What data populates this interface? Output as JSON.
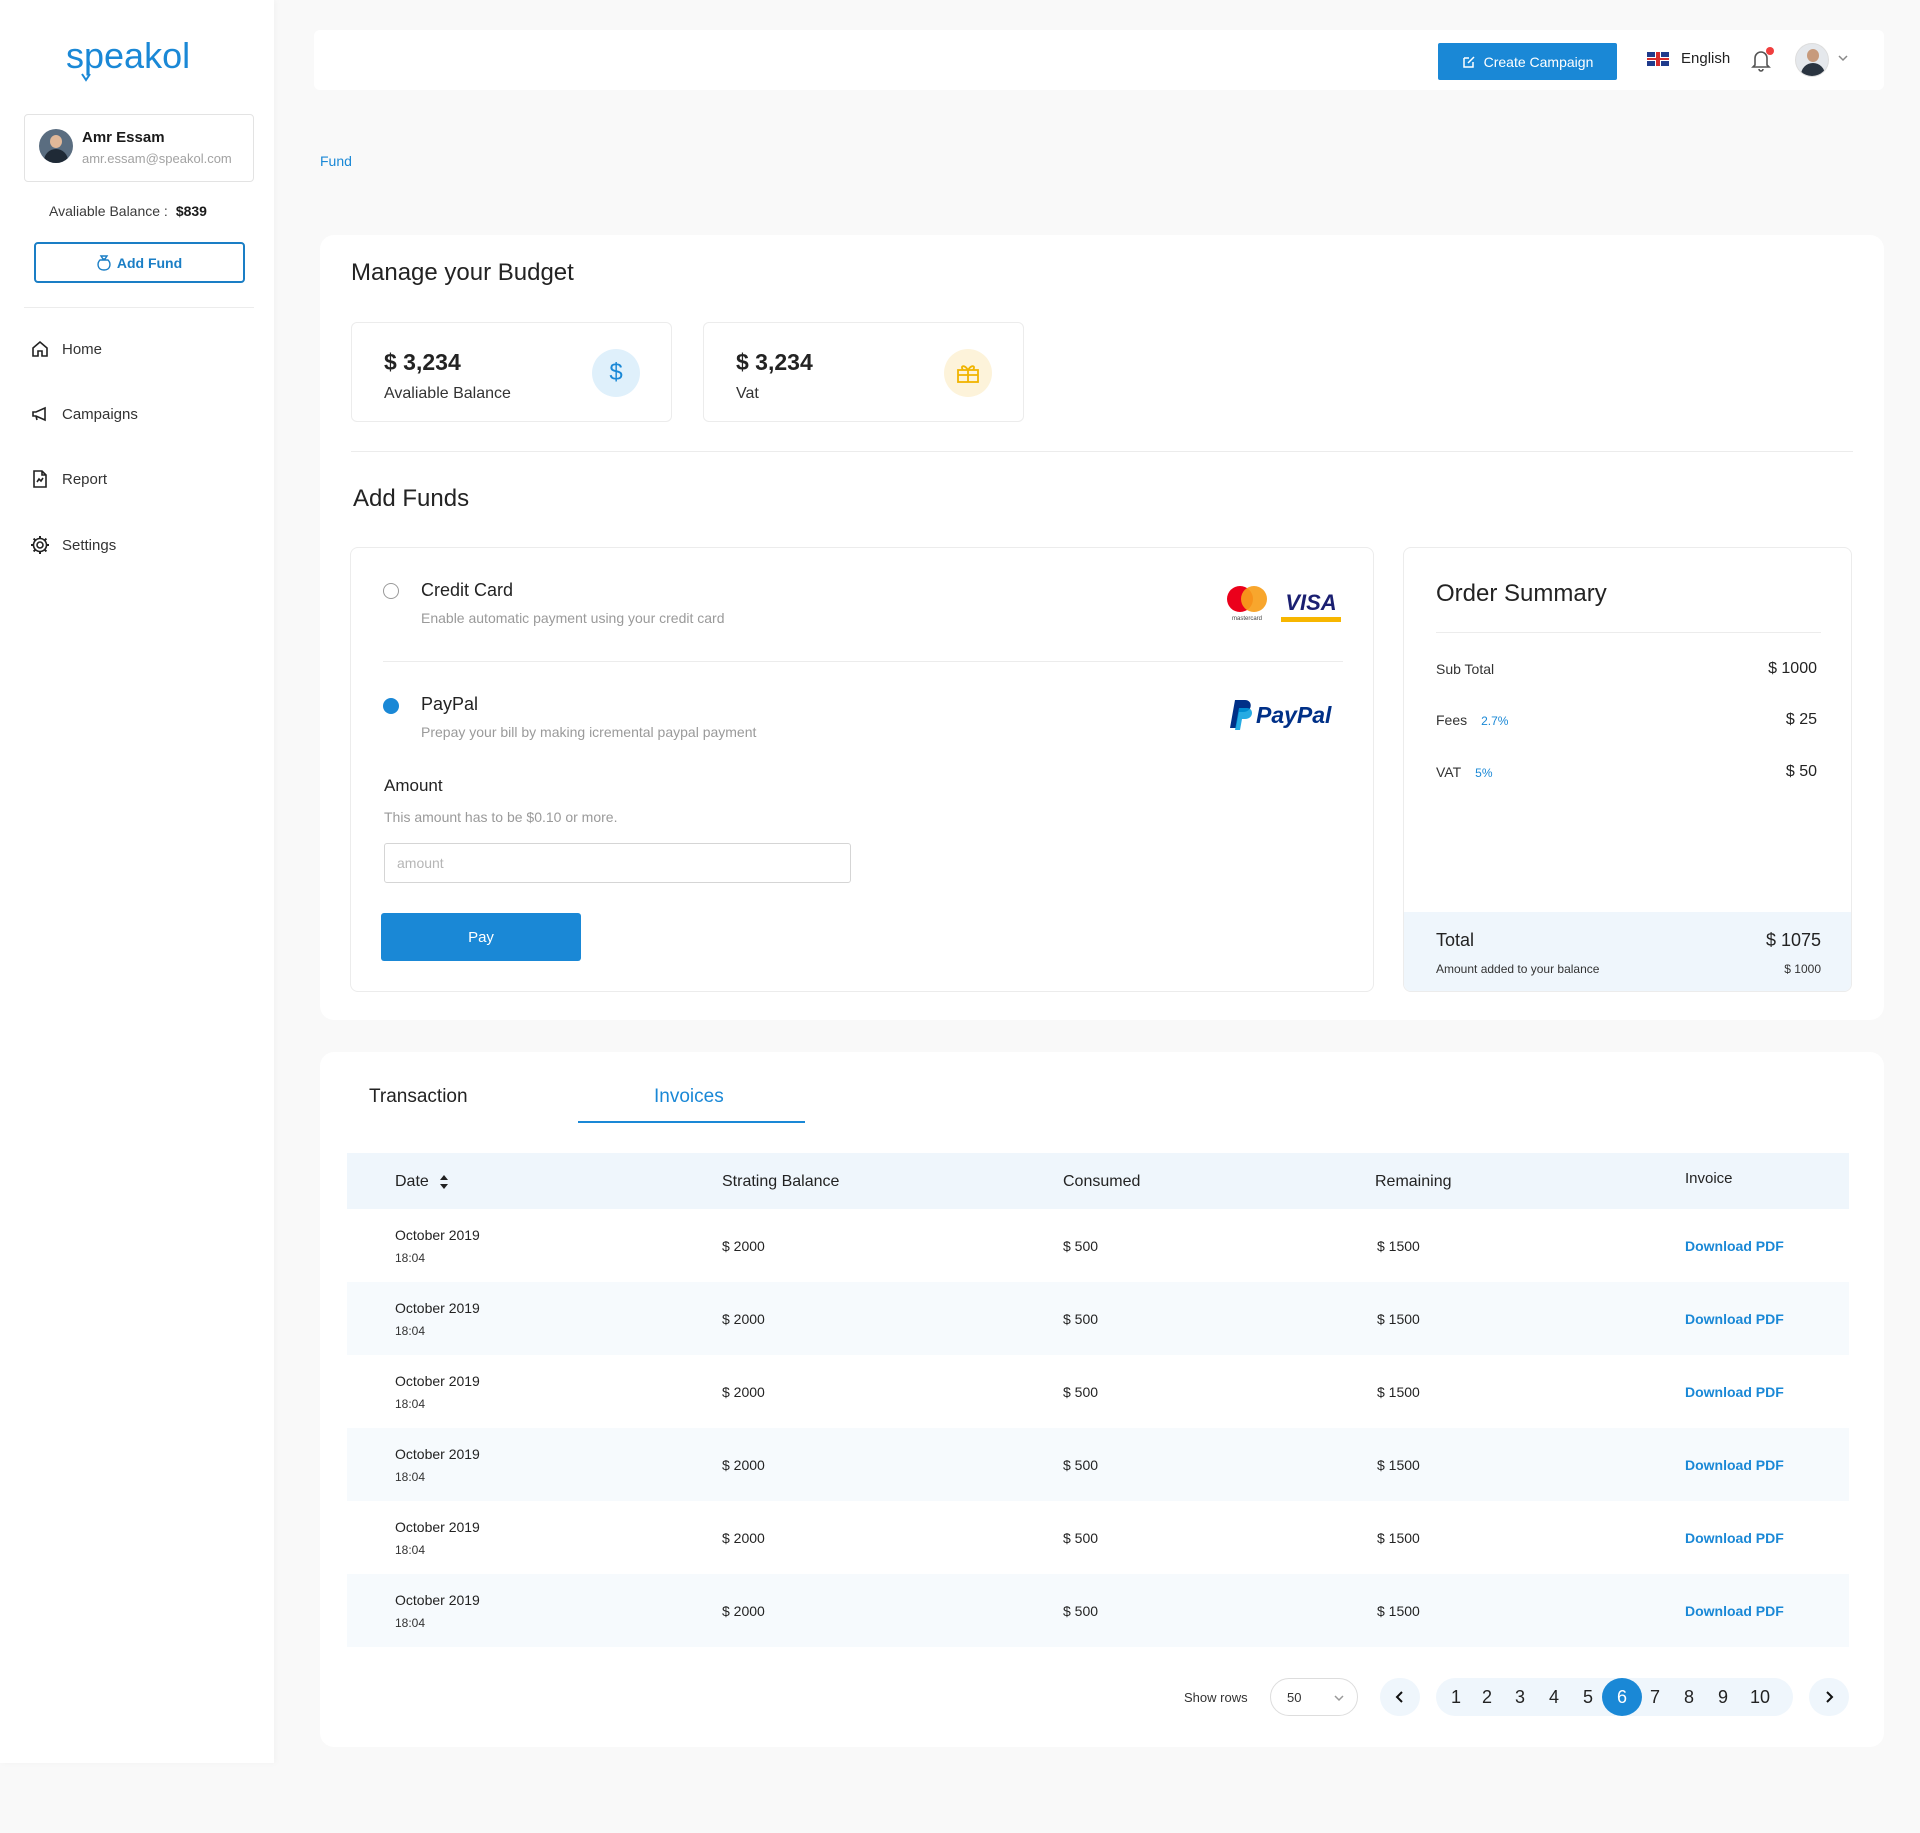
{
  "brand": {
    "name": "speakol",
    "color": "#1a88d6"
  },
  "user": {
    "name": "Amr Essam",
    "email": "amr.essam@speakol.com"
  },
  "sidebar": {
    "balance_label": "Avaliable Balance :",
    "balance_value": "$839",
    "add_fund_label": "Add Fund",
    "items": [
      {
        "label": "Home",
        "icon": "home-icon"
      },
      {
        "label": "Campaigns",
        "icon": "megaphone-icon"
      },
      {
        "label": "Report",
        "icon": "report-icon"
      },
      {
        "label": "Settings",
        "icon": "gear-icon"
      }
    ]
  },
  "topbar": {
    "create_label": "Create Campaign",
    "language": "English"
  },
  "breadcrumb": "Fund",
  "budget": {
    "title": "Manage your Budget",
    "stats": [
      {
        "value": "$ 3,234",
        "label": "Avaliable Balance",
        "icon": "dollar-icon"
      },
      {
        "value": "$ 3,234",
        "label": "Vat",
        "icon": "gift-icon"
      }
    ]
  },
  "add_funds": {
    "title": "Add Funds",
    "options": [
      {
        "title": "Credit Card",
        "desc": "Enable automatic payment using your credit card",
        "selected": false,
        "logos": [
          "mastercard",
          "VISA"
        ]
      },
      {
        "title": "PayPal",
        "desc": "Prepay your bill by making icremental paypal payment",
        "selected": true,
        "logos": [
          "PayPal"
        ]
      }
    ],
    "amount_label": "Amount",
    "amount_help": "This amount has to be $0.10 or more.",
    "amount_placeholder": "amount",
    "pay_label": "Pay"
  },
  "summary": {
    "title": "Order Summary",
    "rows": [
      {
        "label": "Sub Total",
        "rate": "",
        "value": "$ 1000"
      },
      {
        "label": "Fees",
        "rate": "2.7%",
        "value": "$ 25"
      },
      {
        "label": "VAT",
        "rate": "5%",
        "value": "$ 50"
      }
    ],
    "total_label": "Total",
    "total_value": "$ 1075",
    "added_label": "Amount added to your balance",
    "added_value": "$ 1000"
  },
  "tabs": [
    {
      "label": "Transaction",
      "active": false
    },
    {
      "label": "Invoices",
      "active": true
    }
  ],
  "table": {
    "headers": [
      "Date",
      "Strating Balance",
      "Consumed",
      "Remaining",
      "Invoice"
    ],
    "rows": [
      {
        "date": "October 2019",
        "time": "18:04",
        "start": "$ 2000",
        "consumed": "$ 500",
        "remaining": "$ 1500",
        "invoice": "Download PDF"
      },
      {
        "date": "October 2019",
        "time": "18:04",
        "start": "$ 2000",
        "consumed": "$ 500",
        "remaining": "$ 1500",
        "invoice": "Download PDF"
      },
      {
        "date": "October 2019",
        "time": "18:04",
        "start": "$ 2000",
        "consumed": "$ 500",
        "remaining": "$ 1500",
        "invoice": "Download PDF"
      },
      {
        "date": "October 2019",
        "time": "18:04",
        "start": "$ 2000",
        "consumed": "$ 500",
        "remaining": "$ 1500",
        "invoice": "Download PDF"
      },
      {
        "date": "October 2019",
        "time": "18:04",
        "start": "$ 2000",
        "consumed": "$ 500",
        "remaining": "$ 1500",
        "invoice": "Download PDF"
      },
      {
        "date": "October 2019",
        "time": "18:04",
        "start": "$ 2000",
        "consumed": "$ 500",
        "remaining": "$ 1500",
        "invoice": "Download PDF"
      }
    ]
  },
  "pagination": {
    "show_rows_label": "Show rows",
    "rows_value": "50",
    "pages": [
      "1",
      "2",
      "3",
      "4",
      "5",
      "6",
      "7",
      "8",
      "9",
      "10"
    ],
    "active_page": "6"
  }
}
